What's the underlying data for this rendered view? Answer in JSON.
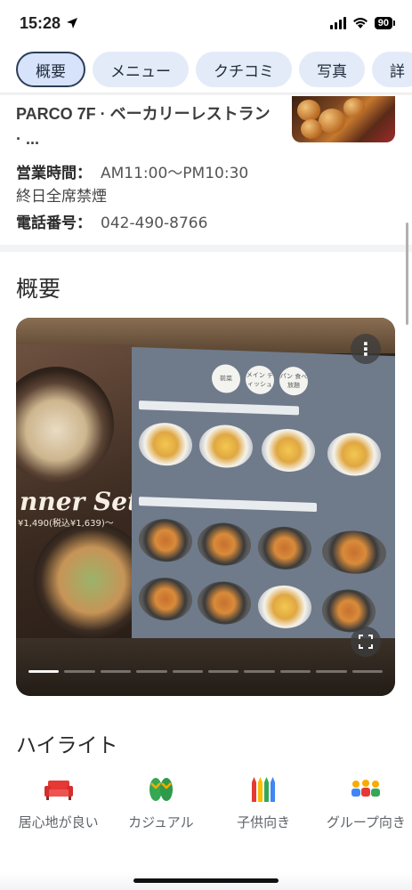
{
  "status_bar": {
    "time": "15:28",
    "battery": "90"
  },
  "tabs": [
    {
      "label": "概要"
    },
    {
      "label": "メニュー"
    },
    {
      "label": "クチコミ"
    },
    {
      "label": "写真"
    },
    {
      "label": "詳"
    }
  ],
  "info": {
    "address_line1": "PARCO 7F · ベーカリーレストラン",
    "address_line2": "· ...",
    "hours_label": "営業時間：",
    "hours_value": "AM11:00〜PM10:30",
    "smoking": "終日全席禁煙",
    "phone_label": "電話番号：",
    "phone_value": "042-490-8766"
  },
  "overview": {
    "title": "概要",
    "photo": {
      "dinner_text": "nner Set",
      "price_text": "¥1,490(税込¥1,639)〜",
      "menu_header": [
        "前菜",
        "メイン ディッシュ",
        "パン 食べ放題"
      ],
      "more_icon": "more-vert-icon",
      "expand_icon": "fullscreen-icon",
      "page_count": 10,
      "current_page": 1
    }
  },
  "highlights": {
    "title": "ハイライト",
    "items": [
      {
        "label": "居心地が良い",
        "icon": "sofa-icon",
        "color": "#e53935"
      },
      {
        "label": "カジュアル",
        "icon": "sandals-icon",
        "color": "#34a853"
      },
      {
        "label": "子供向き",
        "icon": "crayons-icon",
        "color": "#fbbc04"
      },
      {
        "label": "グループ向き",
        "icon": "group-icon",
        "color": "#4285f4"
      }
    ]
  }
}
